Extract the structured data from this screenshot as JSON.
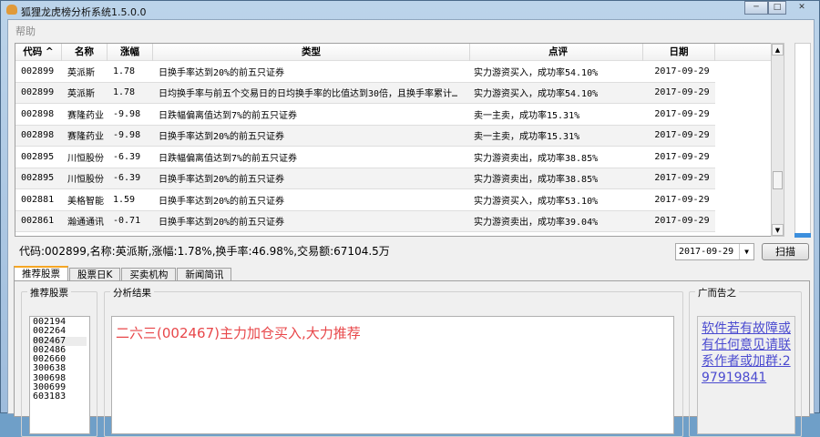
{
  "window": {
    "title": "狐狸龙虎榜分析系统1.5.0.0",
    "minimize": "─",
    "maximize": "□",
    "close": "✕"
  },
  "menu": {
    "help": "帮助"
  },
  "table": {
    "headers": [
      "代码 ^",
      "名称",
      "涨幅",
      "类型",
      "点评",
      "日期"
    ],
    "rows": [
      [
        "002899",
        "英派斯",
        "1.78",
        "日换手率达到20%的前五只证券",
        "实力游资买入，成功率54.10%",
        "2017-09-29"
      ],
      [
        "002899",
        "英派斯",
        "1.78",
        "日均换手率与前五个交易日的日均换手率的比值达到30倍，且换手率累计…",
        "实力游资买入，成功率54.10%",
        "2017-09-29"
      ],
      [
        "002898",
        "赛隆药业",
        "-9.98",
        "日跌幅偏离值达到7%的前五只证券",
        "卖一主卖，成功率15.31%",
        "2017-09-29"
      ],
      [
        "002898",
        "赛隆药业",
        "-9.98",
        "日换手率达到20%的前五只证券",
        "卖一主卖，成功率15.31%",
        "2017-09-29"
      ],
      [
        "002895",
        "川恒股份",
        "-6.39",
        "日跌幅偏离值达到7%的前五只证券",
        "实力游资卖出，成功率38.85%",
        "2017-09-29"
      ],
      [
        "002895",
        "川恒股份",
        "-6.39",
        "日换手率达到20%的前五只证券",
        "实力游资卖出，成功率38.85%",
        "2017-09-29"
      ],
      [
        "002881",
        "美格智能",
        "1.59",
        "日换手率达到20%的前五只证券",
        "实力游资买入，成功率53.10%",
        "2017-09-29"
      ],
      [
        "002861",
        "瀚通通讯",
        "-0.71",
        "日换手率达到20%的前五只证券",
        "实力游资卖出，成功率39.04%",
        "2017-09-29"
      ]
    ]
  },
  "status": "代码:002899,名称:英派斯,涨幅:1.78%,换手率:46.98%,交易额:67104.5万",
  "date_combo": {
    "value": "2017-09-29",
    "arrow": "▼"
  },
  "scan_button": "扫描",
  "tabs": [
    "推荐股票",
    "股票日K",
    "买卖机构",
    "新闻简讯"
  ],
  "recommend": {
    "label": "推荐股票",
    "items": [
      "002194",
      "002264",
      "002467",
      "002486",
      "002660",
      "300638",
      "300698",
      "300699",
      "603183"
    ],
    "selected": "002467"
  },
  "analysis": {
    "label": "分析结果",
    "text": "二六三(002467)主力加仓买入,大力推荐"
  },
  "ad": {
    "label": "广而告之",
    "text": "软件若有故障或有任何意见请联系作者或加群:297919841"
  }
}
